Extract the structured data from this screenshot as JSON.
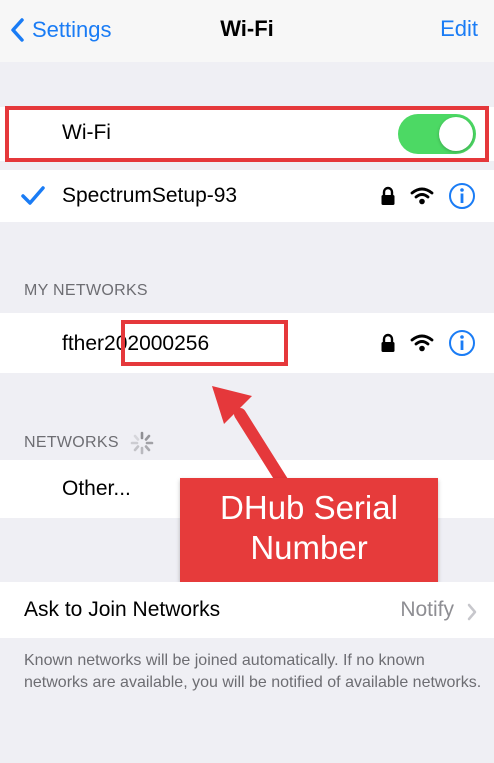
{
  "nav": {
    "back_label": "Settings",
    "title": "Wi-Fi",
    "edit_label": "Edit"
  },
  "wifi_row": {
    "label": "Wi-Fi",
    "toggle_on": true
  },
  "connected_network": {
    "name": "SpectrumSetup-93"
  },
  "my_networks": {
    "header": "MY NETWORKS",
    "network_prefix": "fther",
    "network_serial": "202000256"
  },
  "networks": {
    "header": "NETWORKS",
    "other_label": "Other..."
  },
  "annotation": {
    "line1": "DHub Serial",
    "line2": "Number"
  },
  "ask_to_join": {
    "label": "Ask to Join Networks",
    "value": "Notify"
  },
  "footer": {
    "text": "Known networks will be joined automatically. If no known networks are available, you will be notified of available networks."
  },
  "colors": {
    "accent": "#1a7cf5",
    "toggle_on": "#4cd964",
    "annotation_red": "#e5383b"
  }
}
